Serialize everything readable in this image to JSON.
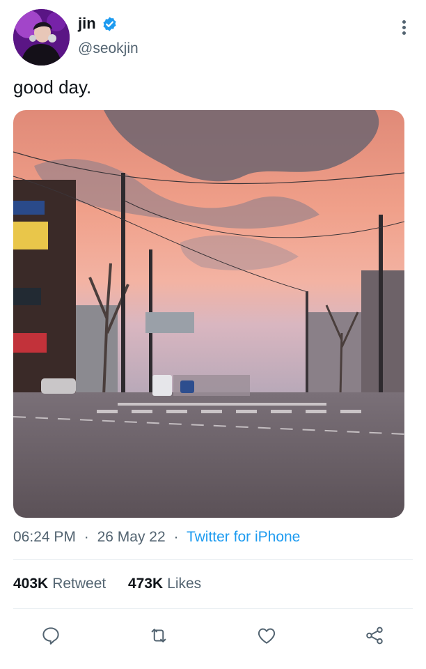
{
  "tweet": {
    "author": {
      "display_name": "jin",
      "handle": "@seokjin",
      "verified": true,
      "avatar_icon": "profile-photo"
    },
    "text": "good day.",
    "media": {
      "type": "photo"
    },
    "meta": {
      "time": "06:24 PM",
      "date": "26 May 22",
      "separator": "·",
      "source": "Twitter for iPhone"
    },
    "stats": {
      "retweets_count": "403K",
      "retweets_label": "Retweet",
      "likes_count": "473K",
      "likes_label": "Likes"
    },
    "actions": [
      {
        "icon": "reply-icon"
      },
      {
        "icon": "retweet-icon"
      },
      {
        "icon": "like-icon"
      },
      {
        "icon": "share-icon"
      }
    ]
  },
  "colors": {
    "text_primary": "#0f1419",
    "text_secondary": "#536471",
    "link": "#1d9bf0",
    "verified": "#1d9bf0",
    "divider": "#e6ecf0"
  }
}
